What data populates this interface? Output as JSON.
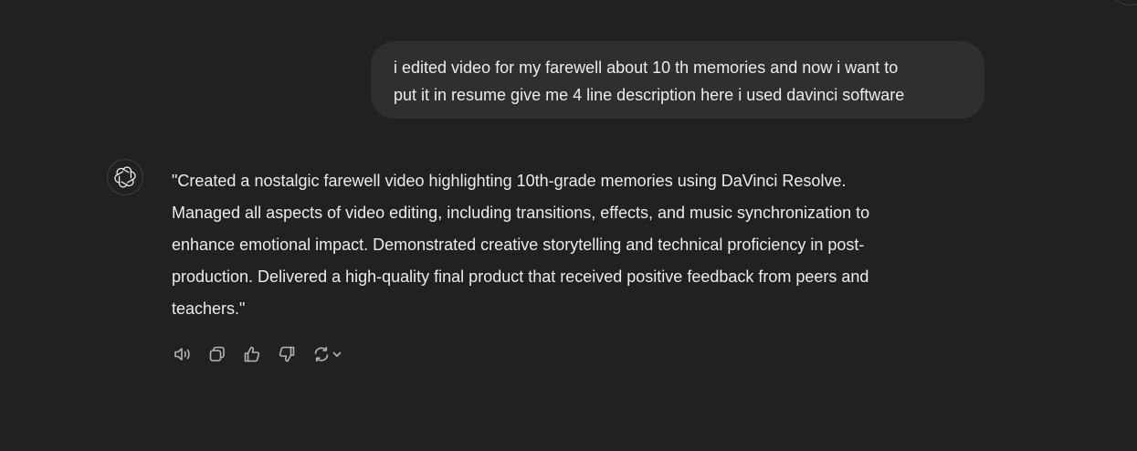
{
  "conversation": {
    "user_message": {
      "lines": [
        "i edited video for my farewell about 10 th memories and now i want to",
        "put it in resume give me 4 line description here i used davinci software"
      ]
    },
    "assistant_message": {
      "avatar_icon": "openai-logo-icon",
      "lines": [
        "\"Created a nostalgic farewell video highlighting 10th-grade memories using DaVinci Resolve.",
        "Managed all aspects of video editing, including transitions, effects, and music synchronization to",
        "enhance emotional impact. Demonstrated creative storytelling and technical proficiency in post-",
        "production. Delivered a high-quality final product that received positive feedback from peers and",
        "teachers.\""
      ]
    },
    "actions": [
      {
        "icon": "read-aloud-icon"
      },
      {
        "icon": "copy-icon"
      },
      {
        "icon": "thumbs-up-icon"
      },
      {
        "icon": "thumbs-down-icon"
      },
      {
        "icon": "regenerate-icon"
      }
    ]
  },
  "colors": {
    "background": "#212121",
    "user_bubble": "#2f2f2f",
    "text": "#ececec",
    "icon": "#b4b4b4"
  }
}
